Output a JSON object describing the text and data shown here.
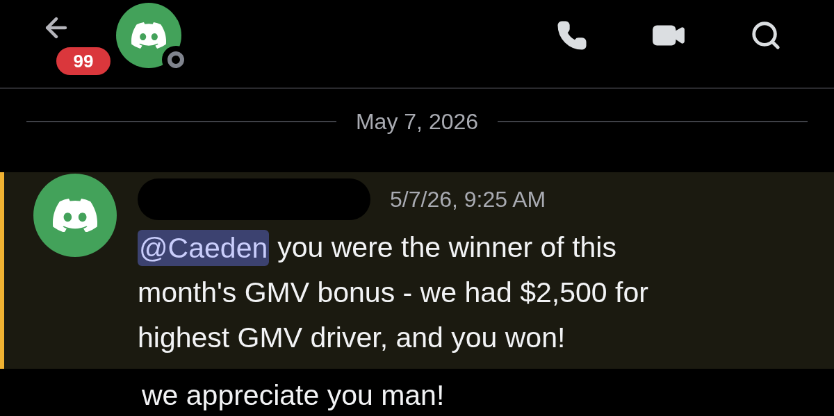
{
  "header": {
    "unread_badge": "99"
  },
  "date_divider": "May 7, 2026",
  "message": {
    "timestamp": "5/7/26, 9:25 AM",
    "highlighted": true,
    "mention": "@Caeden",
    "lines": [
      "you were the winner of this",
      "month's GMV bonus - we had $2,500 for",
      "highest GMV driver, and you won!"
    ]
  },
  "followup": "we appreciate you man!"
}
